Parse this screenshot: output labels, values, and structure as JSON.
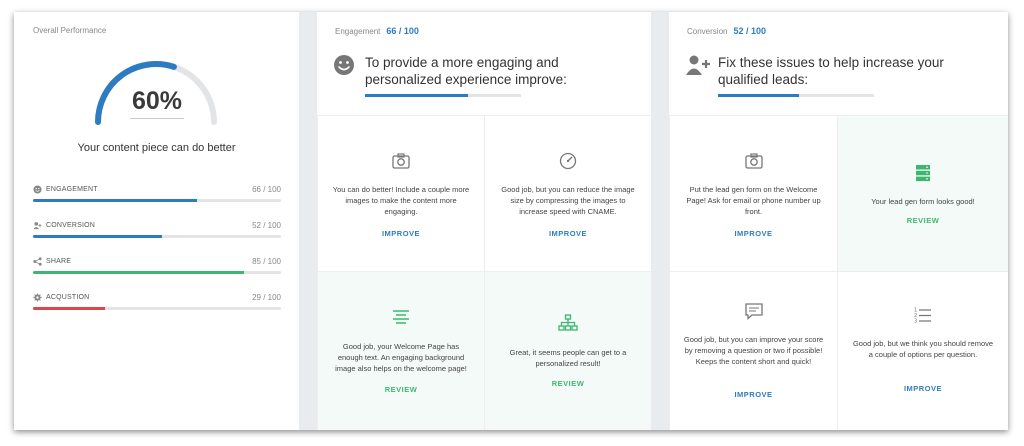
{
  "overall": {
    "title": "Overall Performance",
    "percent_label": "60%",
    "percent": 60,
    "message": "Your content piece can do better",
    "metrics": [
      {
        "label": "ENGAGEMENT",
        "score": "66 / 100",
        "value": 66,
        "color": "#2d7cc1",
        "icon": "smile-icon"
      },
      {
        "label": "CONVERSION",
        "score": "52 / 100",
        "value": 52,
        "color": "#2d7cc1",
        "icon": "user-plus-icon"
      },
      {
        "label": "SHARE",
        "score": "85 / 100",
        "value": 85,
        "color": "#3db76f",
        "icon": "share-icon"
      },
      {
        "label": "ACQUSTION",
        "score": "29 / 100",
        "value": 29,
        "color": "#e0444c",
        "icon": "gear-icon"
      }
    ]
  },
  "engagement": {
    "label": "Engagement",
    "score": "66 / 100",
    "value": 66,
    "heading_line1": "To provide a more engaging and",
    "heading_line2": "personalized experience improve:",
    "cards": [
      {
        "icon": "camera-icon",
        "text": "You can do better! Include a couple more images to make the content more engaging.",
        "action": "IMPROVE"
      },
      {
        "icon": "speedometer-icon",
        "text": "Good job, but you can reduce the image size by compressing the images to increase speed with CNAME.",
        "action": "IMPROVE"
      },
      {
        "icon": "text-lines-icon",
        "text": "Good job, your Welcome Page has enough text. An engaging background image also helps on the welcome page!",
        "action": "REVIEW"
      },
      {
        "icon": "sitemap-icon",
        "text": "Great, it seems people can get to a personalized result!",
        "action": "REVIEW"
      }
    ]
  },
  "conversion": {
    "label": "Conversion",
    "score": "52 / 100",
    "value": 52,
    "heading_line1": "Fix these issues to help increase your",
    "heading_line2": "qualified leads:",
    "cards": [
      {
        "icon": "camera-icon",
        "text": "Put the lead gen form on the Welcome Page! Ask for email or phone number up front.",
        "action": "IMPROVE"
      },
      {
        "icon": "server-icon",
        "text": "Your lead gen form looks good!",
        "action": "REVIEW"
      },
      {
        "icon": "comment-icon",
        "text": "Good job, but you can improve your score by removing a question or two if possible! Keeps the content short and quick!",
        "action": "IMPROVE"
      },
      {
        "icon": "numbered-list-icon",
        "text": "Good job, but we think you should remove a couple of options per question.",
        "action": "IMPROVE"
      }
    ]
  },
  "colors": {
    "blue": "#2d7cc1",
    "green": "#3db76f",
    "red": "#e0444c",
    "gauge_track": "#e2e4e8"
  }
}
